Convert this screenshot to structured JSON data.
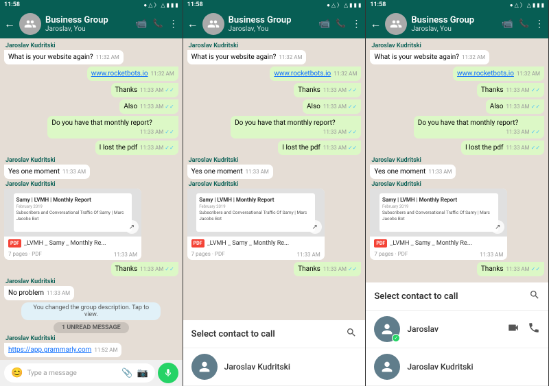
{
  "panels": [
    {
      "id": "panel1",
      "status": {
        "time": "11:58",
        "icons_right": "● ▲ )) ▲ ■ ■ ■"
      },
      "header": {
        "title": "Business Group",
        "subtitle": "Jaroslav, You",
        "back_label": "←",
        "call_icon": "📞",
        "menu_icon": "⋮"
      },
      "messages": [
        {
          "type": "in",
          "sender": "Jaroslav Kudritski",
          "text": "What is your website again?",
          "time": "11:32 AM"
        },
        {
          "type": "out",
          "text": "www.rocketbots.io",
          "time": "11:32 AM",
          "link": true
        },
        {
          "type": "out",
          "text": "Thanks",
          "time": "11:33 AM"
        },
        {
          "type": "out",
          "text": "Also",
          "time": "11:33 AM"
        },
        {
          "type": "out",
          "text": "Do you have that monthly report?",
          "time": "11:33 AM"
        },
        {
          "type": "out",
          "text": "I lost the pdf",
          "time": "11:33 AM"
        },
        {
          "type": "in",
          "sender": "Jaroslav Kudritski",
          "text": "Yes one moment",
          "time": "11:33 AM"
        },
        {
          "type": "file",
          "sender": "Jaroslav Kudritski",
          "report_title": "Samy | LVMH | Monthly Report",
          "report_date": "February 2019",
          "report_sub": "Subscribers and Conversational Traffic Of Samy | Marc Jacobs Bot",
          "file_name": "_LVMH _ Samy _ Monthly Re...",
          "file_meta": "7 pages · PDF",
          "time": "11:33 AM"
        },
        {
          "type": "out",
          "text": "Thanks",
          "time": "11:33 AM"
        },
        {
          "type": "in",
          "sender": "Jaroslav Kudritski",
          "text": "No problem",
          "time": "11:33 AM"
        },
        {
          "type": "sys",
          "text": "You changed the group description. Tap to view."
        },
        {
          "type": "divider",
          "text": "1 UNREAD MESSAGE"
        },
        {
          "type": "in",
          "sender": "Jaroslav Kudritski",
          "text": "https://app.grammarly.com",
          "time": "11:52 AM",
          "link_in": true
        }
      ],
      "input": {
        "placeholder": "Type a message",
        "emoji_icon": "😊",
        "attach_icon": "📎",
        "camera_icon": "📷",
        "mic_icon": "🎤"
      }
    },
    {
      "id": "panel2",
      "status": {
        "time": "11:58"
      },
      "header": {
        "title": "Business Group",
        "subtitle": "Jaroslav, You",
        "back_label": "←",
        "call_icon": "📞",
        "menu_icon": "⋮"
      },
      "messages": [
        {
          "type": "in",
          "sender": "Jaroslav Kudritski",
          "text": "What is your website again?",
          "time": "11:32 AM"
        },
        {
          "type": "out",
          "text": "www.rocketbots.io",
          "time": "11:32 AM",
          "link": true
        },
        {
          "type": "out",
          "text": "Thanks",
          "time": "11:33 AM"
        },
        {
          "type": "out",
          "text": "Also",
          "time": "11:33 AM"
        },
        {
          "type": "out",
          "text": "Do you have that monthly report?",
          "time": "11:33 AM"
        },
        {
          "type": "out",
          "text": "I lost the pdf",
          "time": "11:33 AM"
        },
        {
          "type": "in",
          "sender": "Jaroslav Kudritski",
          "text": "Yes one moment",
          "time": "11:33 AM"
        },
        {
          "type": "file",
          "sender": "Jaroslav Kudritski",
          "report_title": "Samy | LVMH | Monthly Report",
          "report_date": "February 2019",
          "report_sub": "Subscribers and Conversational Traffic Of Samy | Marc Jacobs Bot",
          "file_name": "_LVMH _ Samy _ Monthly Re...",
          "file_meta": "7 pages · PDF",
          "time": "11:33 AM"
        },
        {
          "type": "out",
          "text": "Thanks",
          "time": "11:33 AM"
        }
      ],
      "overlay": {
        "title": "Select contact to call",
        "contacts": [
          {
            "name": "Jaroslav Kudritski",
            "verified": false
          }
        ]
      }
    },
    {
      "id": "panel3",
      "status": {
        "time": "11:58"
      },
      "header": {
        "title": "Business Group",
        "subtitle": "Jaroslav, You",
        "back_label": "←",
        "call_icon": "📞",
        "menu_icon": "⋮"
      },
      "messages": [
        {
          "type": "in",
          "sender": "Jaroslav Kudritski",
          "text": "What is your website again?",
          "time": "11:32 AM"
        },
        {
          "type": "out",
          "text": "www.rocketbots.io",
          "time": "11:32 AM",
          "link": true
        },
        {
          "type": "out",
          "text": "Thanks",
          "time": "11:33 AM"
        },
        {
          "type": "out",
          "text": "Also",
          "time": "11:33 AM"
        },
        {
          "type": "out",
          "text": "Do you have that monthly report?",
          "time": "11:33 AM"
        },
        {
          "type": "out",
          "text": "I lost the pdf",
          "time": "11:33 AM"
        },
        {
          "type": "in",
          "sender": "Jaroslav Kudritski",
          "text": "Yes one moment",
          "time": "11:33 AM"
        },
        {
          "type": "file",
          "sender": "Jaroslav Kudritski",
          "report_title": "Samy | LVMH | Monthly Report",
          "report_date": "February 2019",
          "report_sub": "Subscribers and Conversational Traffic Of Samy | Marc Jacobs Bot",
          "file_name": "_LVMH _ Samy _ Monthly Re...",
          "file_meta": "7 pages · PDF",
          "time": "11:33 AM"
        },
        {
          "type": "out",
          "text": "Thanks",
          "time": "11:33 AM"
        }
      ],
      "overlay": {
        "title": "Select contact to call",
        "contacts": [
          {
            "name": "Jaroslav",
            "verified": true,
            "show_call_icons": true
          },
          {
            "name": "Jaroslav Kudritski",
            "verified": false
          }
        ]
      }
    }
  ]
}
